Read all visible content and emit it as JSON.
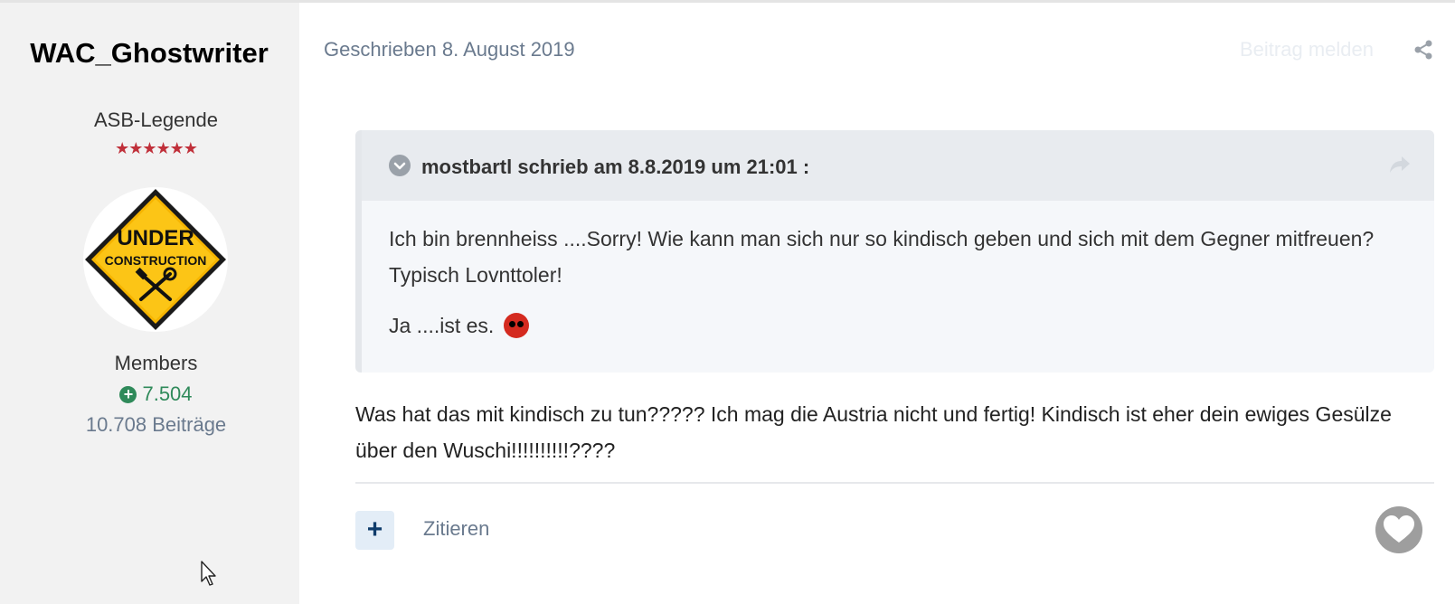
{
  "author": {
    "username": "WAC_Ghostwriter",
    "rank_title": "ASB-Legende",
    "rank_stars": "★★★★★★",
    "avatar_text_line1": "UNDER",
    "avatar_text_line2": "CONSTRUCTION",
    "group": "Members",
    "reputation": "7.504",
    "post_count": "10.708 Beiträge"
  },
  "post": {
    "date": "Geschrieben 8. August 2019",
    "report_label": "Beitrag melden",
    "quote": {
      "author_line": "mostbartl schrieb am 8.8.2019 um 21:01 :",
      "paragraph1": "Ich bin brennheiss ....Sorry! Wie kann man sich nur so kindisch geben und sich mit dem Gegner mitfreuen? Typisch Lovnttoler!",
      "paragraph2": "Ja ....ist es."
    },
    "body": "Was hat das mit kindisch zu tun????? Ich mag die Austria nicht und fertig! Kindisch ist eher dein ewiges Gesülze über den Wuschi!!!!!!!!!!????",
    "actions": {
      "add_label": "+",
      "quote_label": "Zitieren"
    }
  },
  "colors": {
    "sidebar_bg": "#f2f2f2",
    "muted_text": "#6a7a8e",
    "reputation_green": "#2f8a5a",
    "star_red": "#c0303a",
    "quote_bg": "#f5f7fa",
    "quote_header_bg": "#e8ebef",
    "add_button_bg": "#e3edf7",
    "add_button_fg": "#0f3c6b",
    "like_gray": "#9e9e9e"
  },
  "icons": [
    "share-icon",
    "chevron-down-icon",
    "reply-arrow-icon",
    "plus-icon",
    "heart-icon",
    "angry-face-emoji",
    "mouse-cursor-icon"
  ]
}
